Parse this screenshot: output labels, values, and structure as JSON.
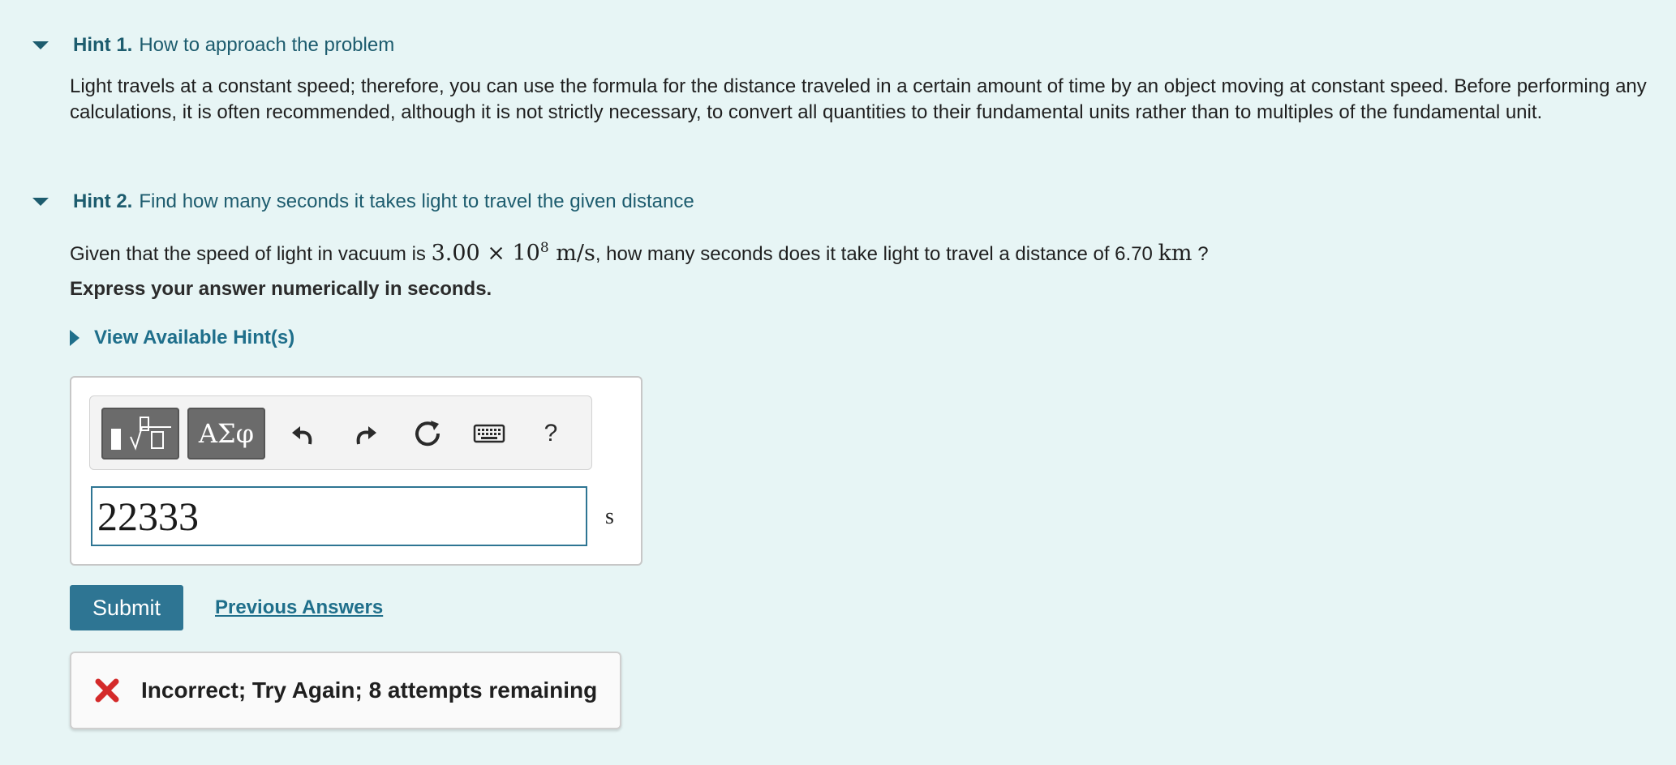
{
  "hint1": {
    "number": "Hint 1.",
    "title": "How to approach the problem",
    "body": "Light travels at a constant speed; therefore, you can use the formula for the distance traveled in a certain amount of time by an object moving at constant speed. Before performing any calculations, it is often recommended, although it is not strictly necessary, to convert all quantities to their fundamental units rather than to multiples of the fundamental unit."
  },
  "hint2": {
    "number": "Hint 2.",
    "title": "Find how many seconds it takes light to travel the given distance",
    "question_pre": "Given that the speed of light in vacuum is ",
    "speed_mantissa": "3.00 × 10",
    "speed_exp": "8",
    "speed_unit": " m/s",
    "question_mid": ", how many seconds does it take light to travel a distance of 6.70 ",
    "distance_unit": "km",
    "question_post": " ?",
    "instruction": "Express your answer numerically in seconds.",
    "view_hints": "View Available Hint(s)"
  },
  "toolbar": {
    "templates_icon": "templates-icon",
    "greek_label": "ΑΣφ",
    "undo_icon": "undo-icon",
    "redo_icon": "redo-icon",
    "reset_icon": "reset-icon",
    "keyboard_icon": "keyboard-icon",
    "help_label": "?"
  },
  "answer": {
    "value": "22333",
    "unit": "s"
  },
  "actions": {
    "submit": "Submit",
    "previous_answers": "Previous Answers"
  },
  "feedback": {
    "text": "Incorrect; Try Again; 8 attempts remaining",
    "icon": "x-icon",
    "icon_color": "#d42a2a"
  },
  "colors": {
    "background": "#e7f5f5",
    "accent": "#2e7593",
    "heading": "#1d5c6e"
  }
}
